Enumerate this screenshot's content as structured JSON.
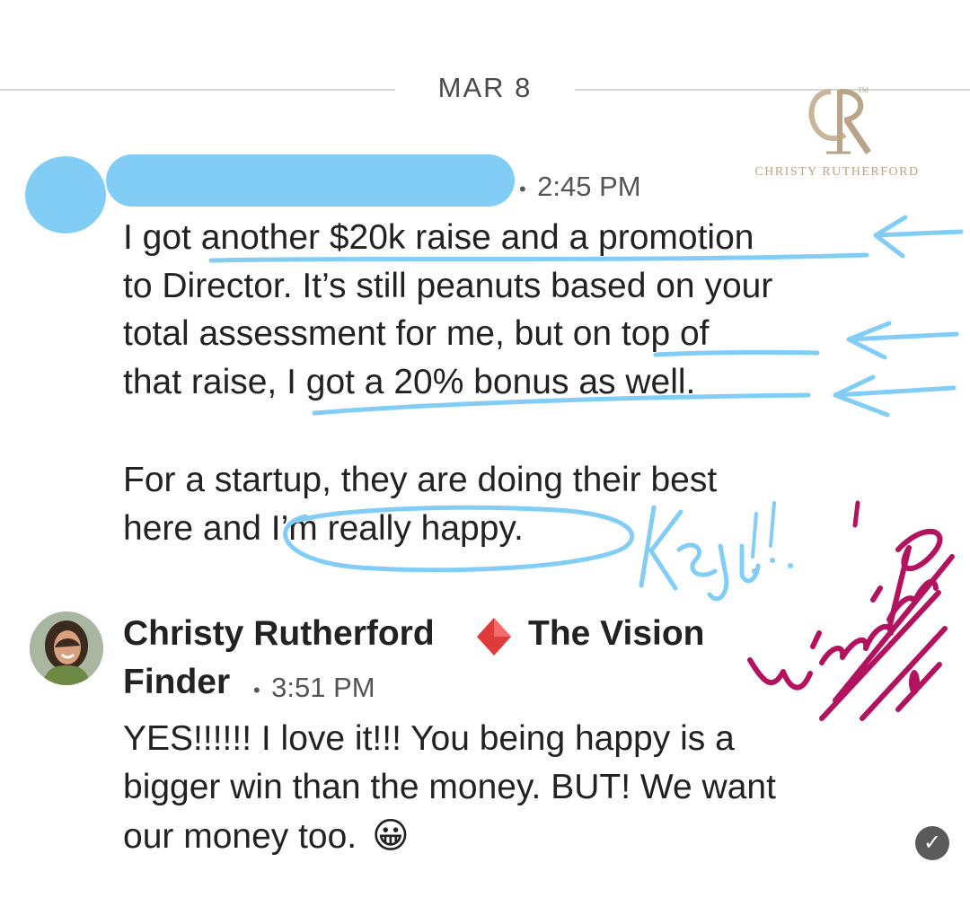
{
  "date_divider": "MAR 8",
  "brand": {
    "name": "CHRISTY RUTHERFORD",
    "trademark": "TM",
    "monogram": "CR"
  },
  "first_message": {
    "time": "2:45 PM",
    "lines": [
      "I got another $20k raise and a promotion",
      "to Director. It’s still peanuts based on your",
      "total assessment for me, but on top of",
      "that raise, I got a 20% bonus as well.",
      "For a startup, they are doing their best",
      "here and I’m really happy."
    ]
  },
  "reply": {
    "sender_name_part1": "Christy Rutherford",
    "sender_name_part2": "The Vision",
    "sender_name_part3": "Finder",
    "time": "3:51 PM",
    "lines": [
      "YES!!!!!! I love it!!! You being happy is a",
      "bigger win than the money. BUT! We want",
      "our money too."
    ],
    "emoji": "😀"
  },
  "annotations": {
    "key_note": "Key!!..",
    "winning_note": "Winning"
  },
  "colors": {
    "highlight_blue": "#82cdf6",
    "ink_magenta": "#b3125f",
    "diamond_red": "#e03a3a"
  },
  "icons": {
    "sent_status": "check-circle-icon",
    "separator": "diamond-icon"
  },
  "status_glyph": "✓"
}
